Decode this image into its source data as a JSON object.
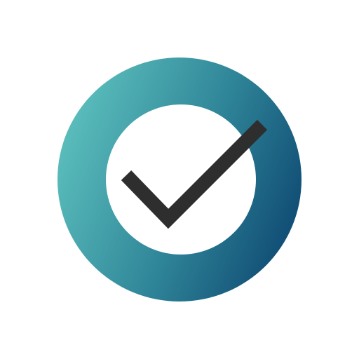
{
  "icon": {
    "name": "check-circle-icon",
    "colors": {
      "background": "#ffffff",
      "ring_gradient_start": "#5cc0bd",
      "ring_gradient_mid": "#2f8598",
      "ring_gradient_end": "#0f4a73",
      "inner_fill": "#ffffff",
      "checkmark": "#2e2e2e"
    }
  }
}
